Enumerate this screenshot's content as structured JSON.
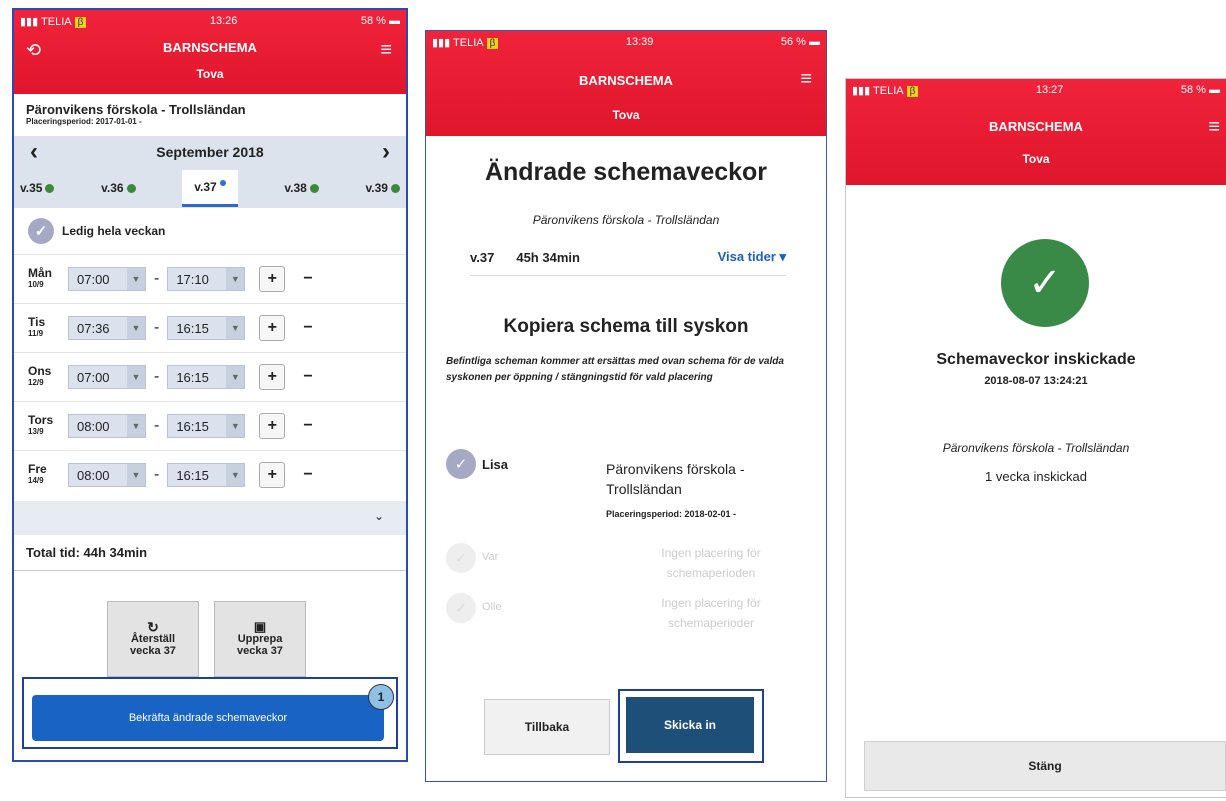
{
  "screen1": {
    "status": {
      "carrier": "TELIA",
      "beta": "β",
      "time": "13:26",
      "battery": "58 %"
    },
    "title": "BARNSCHEMA",
    "child": "Tova",
    "school": "Päronvikens förskola - Trollsländan",
    "period": "Placeringsperiod: 2017-01-01 -",
    "month": "September 2018",
    "prev": "‹",
    "next": "›",
    "weeks": [
      {
        "label": "v.35",
        "status": "green"
      },
      {
        "label": "v.36",
        "status": "green"
      },
      {
        "label": "v.37",
        "status": "blue"
      },
      {
        "label": "v.38",
        "status": "green"
      },
      {
        "label": "v.39",
        "status": "green"
      }
    ],
    "free_week": "Ledig hela veckan",
    "days": [
      {
        "day": "Mån",
        "date": "10/9",
        "start": "07:00",
        "end": "17:10"
      },
      {
        "day": "Tis",
        "date": "11/9",
        "start": "07:36",
        "end": "16:15"
      },
      {
        "day": "Ons",
        "date": "12/9",
        "start": "07:00",
        "end": "16:15"
      },
      {
        "day": "Tors",
        "date": "13/9",
        "start": "08:00",
        "end": "16:15"
      },
      {
        "day": "Fre",
        "date": "14/9",
        "start": "08:00",
        "end": "16:15"
      }
    ],
    "total": "Total tid: 44h 34min",
    "reset": {
      "line1": "Återställ",
      "line2": "vecka 37"
    },
    "repeat": {
      "line1": "Upprepa",
      "line2": "vecka 37"
    },
    "confirm": "Bekräfta ändrade schemaveckor",
    "badge": "1"
  },
  "screen2": {
    "status": {
      "carrier": "TELIA",
      "beta": "β",
      "time": "13:39",
      "battery": "56 %"
    },
    "title": "BARNSCHEMA",
    "child": "Tova",
    "heading": "Ändrade schemaveckor",
    "school": "Päronvikens förskola - Trollsländan",
    "week": "v.37",
    "duration": "45h 34min",
    "show_times": "Visa tider ▾",
    "copy_heading": "Kopiera schema till syskon",
    "copy_text": "Befintliga scheman kommer att ersättas med ovan schema för de valda syskonen per öppning / stängningstid för vald placering",
    "siblings": [
      {
        "name": "Lisa",
        "school": "Päronvikens förskola - Trollsländan",
        "period": "Placeringsperiod: 2018-02-01 -"
      },
      {
        "name": "Var",
        "school": "Ingen placering för schemaperioden"
      },
      {
        "name": "Olle",
        "school": "Ingen placering för schemaperioder"
      }
    ],
    "back": "Tillbaka",
    "send": "Skicka in"
  },
  "screen3": {
    "status": {
      "carrier": "TELIA",
      "beta": "β",
      "time": "13:27",
      "battery": "58 %"
    },
    "title": "BARNSCHEMA",
    "child": "Tova",
    "success": "Schemaveckor inskickade",
    "timestamp": "2018-08-07 13:24:21",
    "school": "Päronvikens förskola - Trollsländan",
    "count": "1 vecka inskickad",
    "close": "Stäng"
  }
}
